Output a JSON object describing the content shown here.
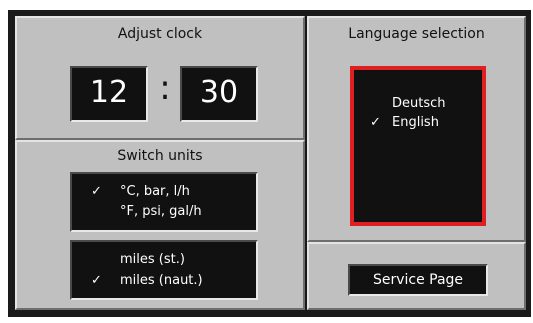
{
  "clock": {
    "title": "Adjust clock",
    "hours": "12",
    "separator": ":",
    "minutes": "30"
  },
  "units": {
    "title": "Switch units",
    "temperature_options": [
      "°C, bar, l/h",
      "°F, psi, gal/h"
    ],
    "temperature_selected": 0,
    "distance_options": [
      "miles (st.)",
      "miles (naut.)"
    ],
    "distance_selected": 1,
    "check_mark": "✓"
  },
  "language": {
    "title": "Language selection",
    "options": [
      "Deutsch",
      "English"
    ],
    "selected": 1,
    "check_mark": "✓",
    "highlight_color": "#e02020"
  },
  "service": {
    "button_label": "Service Page"
  }
}
